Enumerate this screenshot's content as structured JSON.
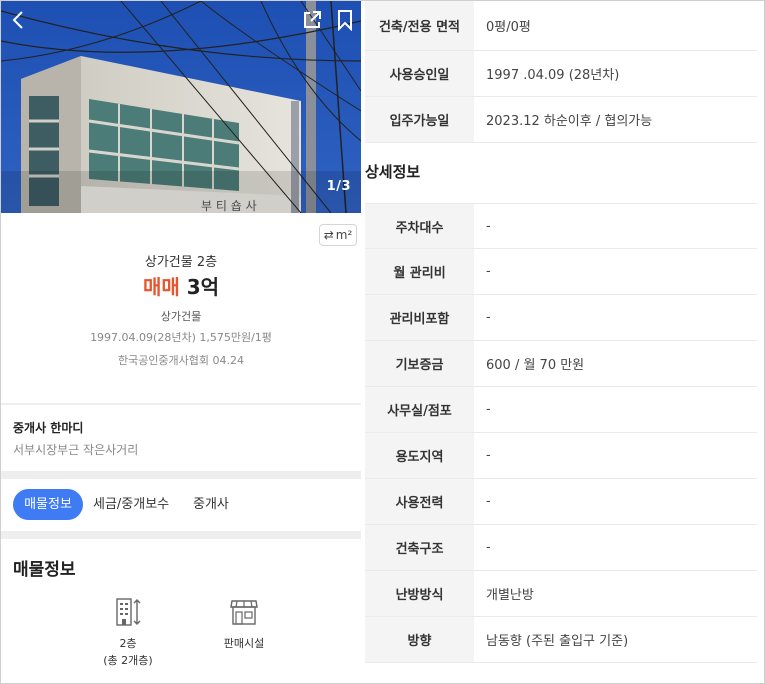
{
  "photo": {
    "counter": "1/3",
    "sign_text": "부 티 숍 사",
    "icons": {
      "back": "chevron-left-icon",
      "share": "share-icon",
      "bookmark": "bookmark-icon"
    }
  },
  "summary": {
    "unit_toggle": "m²",
    "sub_type": "상가건물 2층",
    "deal_type": "매매",
    "price": "3억",
    "category": "상가건물",
    "meta": "1997.04.09(28년차)  1,575만원/1평",
    "agency": "한국공인중개사협회 04.24"
  },
  "comment": {
    "title": "중개사 한마디",
    "text": "서부시장부근 작은사거리"
  },
  "tabs": [
    {
      "label": "매물정보",
      "active": true
    },
    {
      "label": "세금/중개보수",
      "active": false
    },
    {
      "label": "중개사",
      "active": false
    }
  ],
  "listing": {
    "title": "매물정보",
    "features": [
      {
        "icon": "building-floor-icon",
        "line1": "2층",
        "line2": "(총 2개층)"
      },
      {
        "icon": "storefront-icon",
        "line1": "판매시설",
        "line2": ""
      }
    ]
  },
  "top_table": [
    {
      "key": "건축/전용 면적",
      "value": "0평/0평"
    },
    {
      "key": "사용승인일",
      "value": "1997 .04.09 (28년차)"
    },
    {
      "key": "입주가능일",
      "value": "2023.12 하순이후 / 협의가능"
    }
  ],
  "detail": {
    "title": "상세정보",
    "rows": [
      {
        "key": "주차대수",
        "value": "-"
      },
      {
        "key": "월 관리비",
        "value": "-"
      },
      {
        "key": "관리비포함",
        "value": "-"
      },
      {
        "key": "기보증금",
        "value": "600 / 월 70 만원"
      },
      {
        "key": "사무실/점포",
        "value": "-"
      },
      {
        "key": "용도지역",
        "value": "-"
      },
      {
        "key": "사용전력",
        "value": "-"
      },
      {
        "key": "건축구조",
        "value": "-"
      },
      {
        "key": "난방방식",
        "value": "개별난방"
      },
      {
        "key": "방향",
        "value": "남동향 (주된 출입구 기준)"
      }
    ]
  },
  "colors": {
    "accent": "#3f7bf3",
    "deal": "#e8552d",
    "label_bg": "#f4f4f4"
  }
}
